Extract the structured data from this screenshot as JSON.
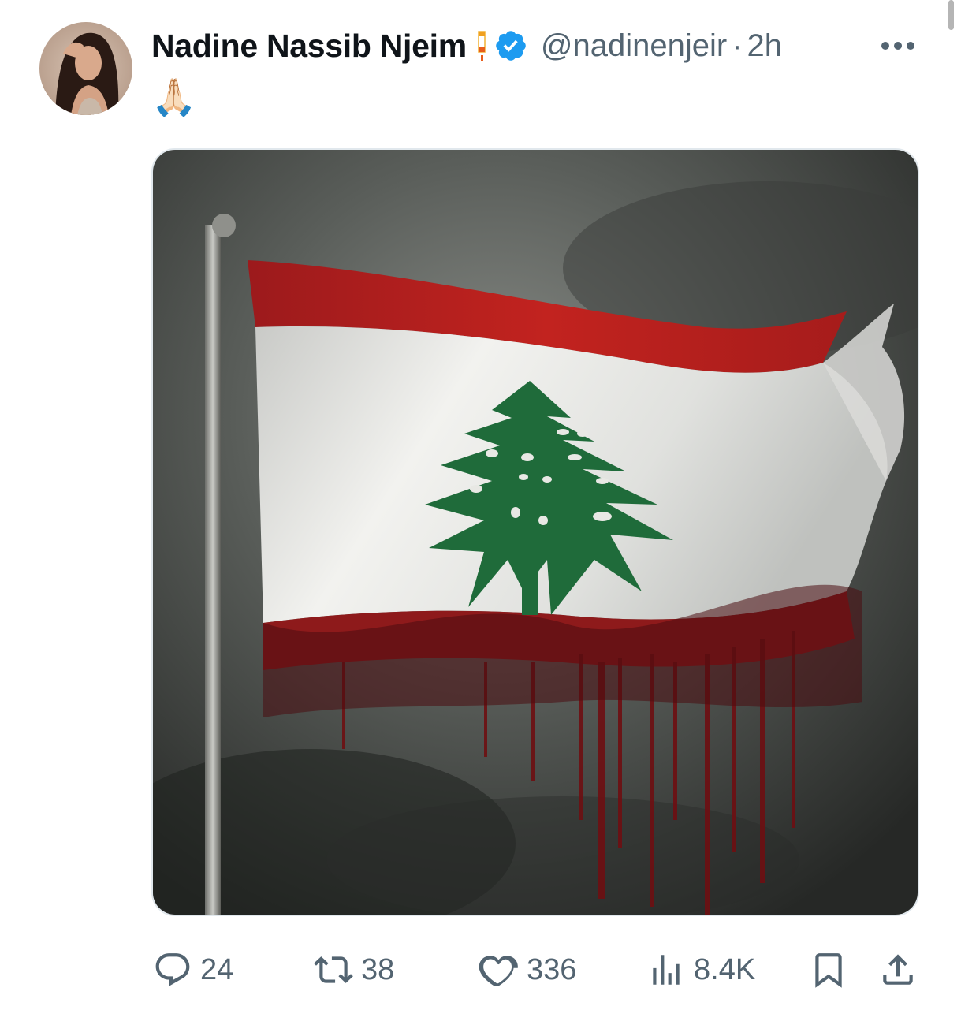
{
  "author": {
    "display_name": "Nadine Nassib Njeim",
    "handle": "@nadinenjeir",
    "separator": "·",
    "timestamp": "2h",
    "verified": true
  },
  "tweet": {
    "text": "🙏🏻"
  },
  "media": {
    "kind": "image",
    "description_icon": "lebanese-flag-image"
  },
  "actions": {
    "replies": "24",
    "reposts": "38",
    "likes": "336",
    "views": "8.4K"
  },
  "colors": {
    "text_primary": "#0f1419",
    "text_secondary": "#536471",
    "verified_blue": "#1d9bf0",
    "flag_red": "#c8102e",
    "cedar_green": "#00843d"
  }
}
